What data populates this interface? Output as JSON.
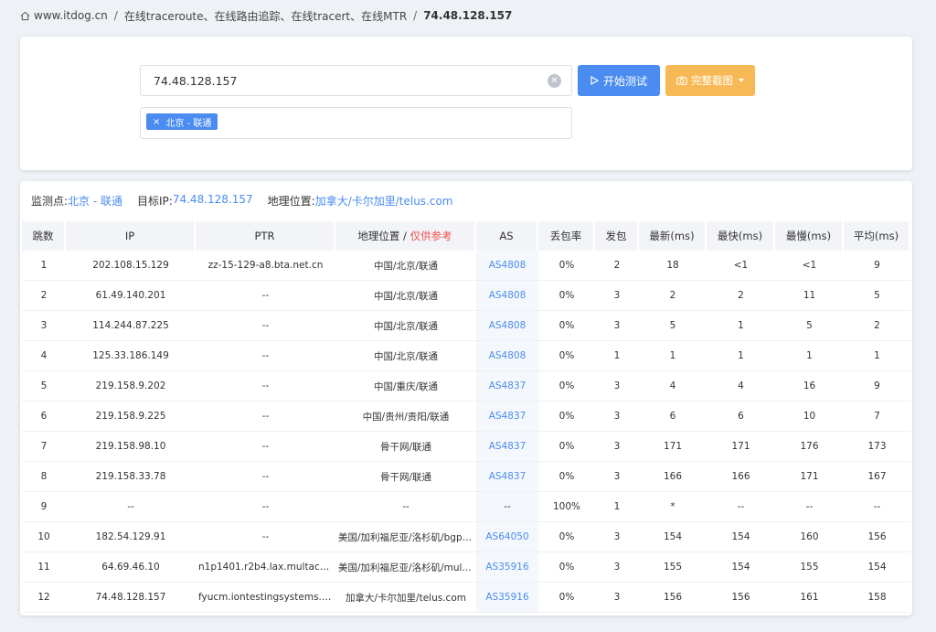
{
  "breadcrumb": {
    "home": "www.itdog.cn",
    "section": "在线traceroute、在线路由追踪、在线tracert、在线MTR",
    "current": "74.48.128.157"
  },
  "search": {
    "value": "74.48.128.157"
  },
  "buttons": {
    "start": "开始测试",
    "screenshot": "完整截图"
  },
  "node_tag": {
    "label": "北京 - 联通",
    "close": "×"
  },
  "info": {
    "monitor_label": "监测点:",
    "monitor_value": "北京 - 联通",
    "target_label": "目标IP:",
    "target_value": "74.48.128.157",
    "geo_label": "地理位置:",
    "geo_value": "加拿大/卡尔加里/telus.com"
  },
  "table": {
    "headers": [
      "跳数",
      "IP",
      "PTR",
      "地理位置 / ",
      "AS",
      "丢包率",
      "发包",
      "最新(ms)",
      "最快(ms)",
      "最慢(ms)",
      "平均(ms)"
    ],
    "geo_note": "仅供参考",
    "rows": [
      [
        "1",
        "202.108.15.129",
        "zz-15-129-a8.bta.net.cn",
        "中国/北京/联通",
        "AS4808",
        "0%",
        "2",
        "18",
        "<1",
        "<1",
        "9"
      ],
      [
        "2",
        "61.49.140.201",
        "--",
        "中国/北京/联通",
        "AS4808",
        "0%",
        "3",
        "2",
        "2",
        "11",
        "5"
      ],
      [
        "3",
        "114.244.87.225",
        "--",
        "中国/北京/联通",
        "AS4808",
        "0%",
        "3",
        "5",
        "1",
        "5",
        "2"
      ],
      [
        "4",
        "125.33.186.149",
        "--",
        "中国/北京/联通",
        "AS4808",
        "0%",
        "1",
        "1",
        "1",
        "1",
        "1"
      ],
      [
        "5",
        "219.158.9.202",
        "--",
        "中国/重庆/联通",
        "AS4837",
        "0%",
        "3",
        "4",
        "4",
        "16",
        "9"
      ],
      [
        "6",
        "219.158.9.225",
        "--",
        "中国/贵州/贵阳/联通",
        "AS4837",
        "0%",
        "3",
        "6",
        "6",
        "10",
        "7"
      ],
      [
        "7",
        "219.158.98.10",
        "--",
        "骨干网/联通",
        "AS4837",
        "0%",
        "3",
        "171",
        "171",
        "176",
        "173"
      ],
      [
        "8",
        "219.158.33.78",
        "--",
        "骨干网/联通",
        "AS4837",
        "0%",
        "3",
        "166",
        "166",
        "171",
        "167"
      ],
      [
        "9",
        "--",
        "--",
        "--",
        "--",
        "100%",
        "1",
        "*",
        "--",
        "--",
        "--"
      ],
      [
        "10",
        "182.54.129.91",
        "--",
        "美国/加利福尼亚/洛杉矶/bgp....",
        "AS64050",
        "0%",
        "3",
        "154",
        "154",
        "160",
        "156"
      ],
      [
        "11",
        "64.69.46.10",
        "n1p1401.r2b4.lax.multacom....",
        "美国/加利福尼亚/洛杉矶/mult...",
        "AS35916",
        "0%",
        "3",
        "155",
        "154",
        "155",
        "154"
      ],
      [
        "12",
        "74.48.128.157",
        "fyucm.iontestingsystems.com",
        "加拿大/卡尔加里/telus.com",
        "AS35916",
        "0%",
        "3",
        "156",
        "156",
        "161",
        "158"
      ]
    ]
  }
}
